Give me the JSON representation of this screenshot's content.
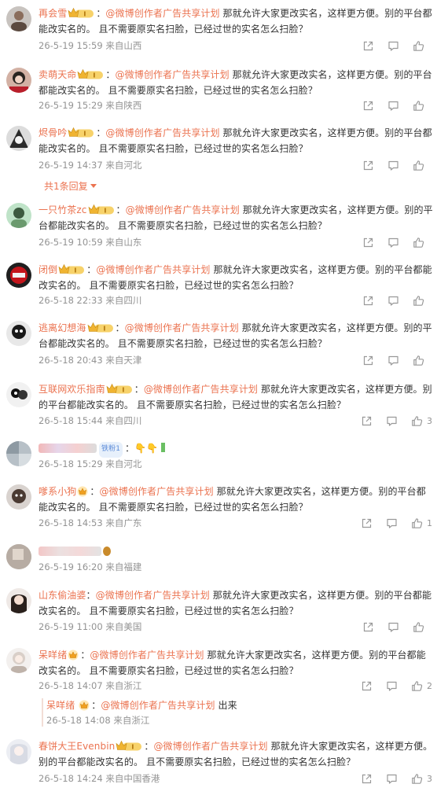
{
  "text_common": "那就允许大家更改实名，这样更方便。别的平台都能改实名的。 且不需要原实名扫脸，已经过世的实名怎么扫脸？",
  "mention_text": "@微博创作者广告共享计划",
  "colors": {
    "accent": "#eb7350",
    "meta": "#939393",
    "body": "#333333"
  },
  "comments": [
    {
      "user": "再会雪",
      "meta": "26-5-19 15:59 来自山西",
      "likes": ""
    },
    {
      "user": "卖萌天命",
      "meta": "26-5-19 15:29 来自陕西",
      "likes": ""
    },
    {
      "user": "烬骨吟",
      "meta": "26-5-19 14:37 来自河北",
      "likes": "",
      "more_replies": "共1条回复"
    },
    {
      "user": "一只竹茶zc",
      "meta": "26-5-19 10:59 来自山东",
      "likes": ""
    },
    {
      "user": "闭倒",
      "meta": "26-5-18 22:33 来自四川",
      "likes": ""
    },
    {
      "user": "逃离幻想海",
      "meta": "26-5-18 20:43 来自天津",
      "likes": ""
    },
    {
      "user": "互联网欢乐指南",
      "meta": "26-5-18 15:44 来自四川",
      "likes": "3"
    },
    {
      "user": "",
      "meta": "26-5-18 15:29 来自河北",
      "likes": "",
      "badge_text": "铁粉1",
      "emoji": "👇👇"
    },
    {
      "user": "嗲系小狗",
      "meta": "26-5-18 14:53 来自广东",
      "likes": "1"
    },
    {
      "user": "",
      "meta": "26-5-19 16:20 来自福建",
      "likes": ""
    },
    {
      "user": "山东偷油婆",
      "meta": "26-5-19 11:00 来自美国",
      "likes": ""
    },
    {
      "user": "呆咩绪",
      "meta": "26-5-18 14:07 来自浙江",
      "likes": "2"
    },
    {
      "user": "春饼大王Evenbin",
      "meta": "26-5-18 14:24 来自中国香港",
      "likes": "3"
    }
  ],
  "reply": {
    "user": "呆咩绪",
    "text": "出来",
    "meta": "26-5-18 14:08 来自浙江"
  },
  "icons": [
    "share-icon",
    "comment-icon",
    "like-icon",
    "vip-crown-badge",
    "gold-crown-badge"
  ]
}
